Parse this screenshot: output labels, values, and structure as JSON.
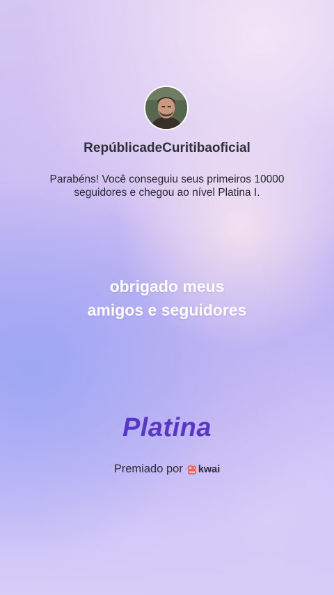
{
  "profile": {
    "username": "RepúblicadeCuritibaoficial",
    "avatar_icon": "user-avatar-photo"
  },
  "message": {
    "line1": "Parabéns! Você conseguiu seus primeiros 10000",
    "line2": "seguidores e chegou ao nível Platina I."
  },
  "thanks": {
    "line1": "obrigado meus",
    "line2": "amigos e seguidores"
  },
  "level": {
    "name": "Platina",
    "color": "#5a36c7"
  },
  "award": {
    "prefix": "Premiado por",
    "brand": "kwai",
    "brand_icon": "kwai-logo-icon",
    "brand_color": "#ff5a2b"
  }
}
